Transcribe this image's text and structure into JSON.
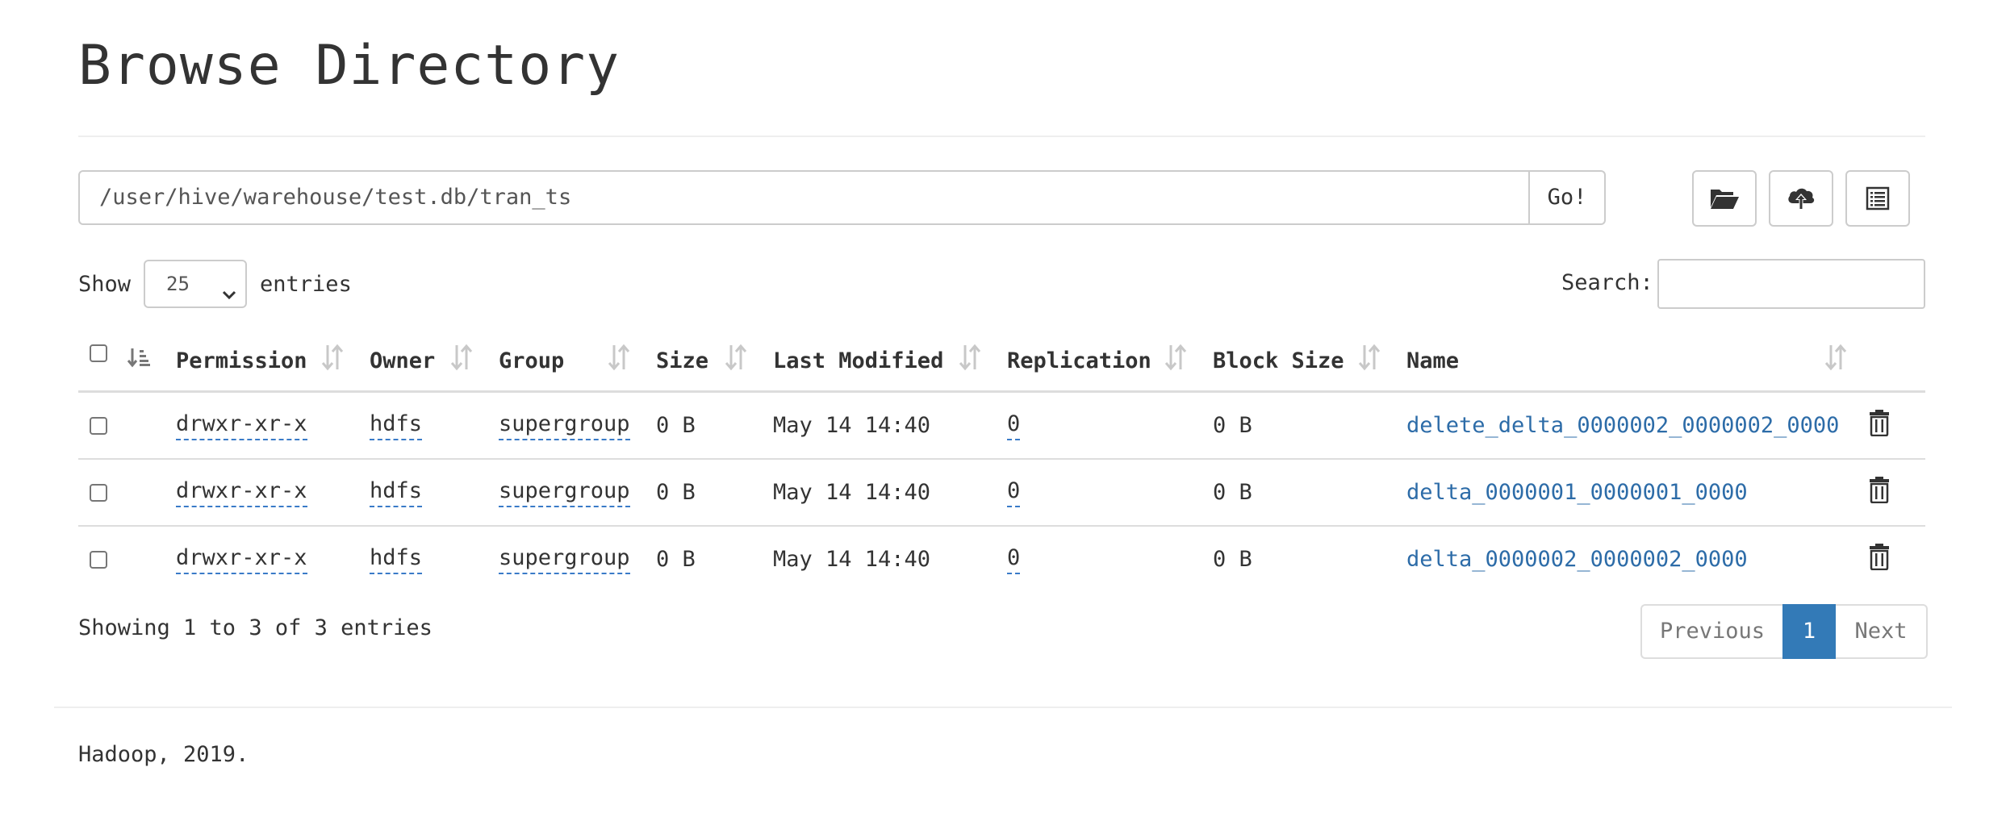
{
  "page": {
    "title": "Browse Directory"
  },
  "path_bar": {
    "value": "/user/hive/warehouse/test.db/tran_ts",
    "go_label": "Go!"
  },
  "toolbar": {
    "icons": [
      "folder-open-icon",
      "cloud-upload-icon",
      "list-alt-icon"
    ]
  },
  "length_control": {
    "prefix": "Show",
    "selected": "25",
    "suffix": "entries"
  },
  "search": {
    "label": "Search:",
    "value": ""
  },
  "table": {
    "columns": [
      "Permission",
      "Owner",
      "Group",
      "Size",
      "Last Modified",
      "Replication",
      "Block Size",
      "Name"
    ],
    "rows": [
      {
        "permission": "drwxr-xr-x",
        "owner": "hdfs",
        "group": "supergroup",
        "size": "0 B",
        "last_modified": "May 14 14:40",
        "replication": "0",
        "block_size": "0 B",
        "name": "delete_delta_0000002_0000002_0000"
      },
      {
        "permission": "drwxr-xr-x",
        "owner": "hdfs",
        "group": "supergroup",
        "size": "0 B",
        "last_modified": "May 14 14:40",
        "replication": "0",
        "block_size": "0 B",
        "name": "delta_0000001_0000001_0000"
      },
      {
        "permission": "drwxr-xr-x",
        "owner": "hdfs",
        "group": "supergroup",
        "size": "0 B",
        "last_modified": "May 14 14:40",
        "replication": "0",
        "block_size": "0 B",
        "name": "delta_0000002_0000002_0000"
      }
    ]
  },
  "info": "Showing 1 to 3 of 3 entries",
  "pagination": {
    "previous": "Previous",
    "current": "1",
    "next": "Next"
  },
  "footer": "Hadoop, 2019.",
  "colors": {
    "link": "#2d6ca8",
    "active_page": "#337ab7",
    "border": "#dddddd"
  }
}
